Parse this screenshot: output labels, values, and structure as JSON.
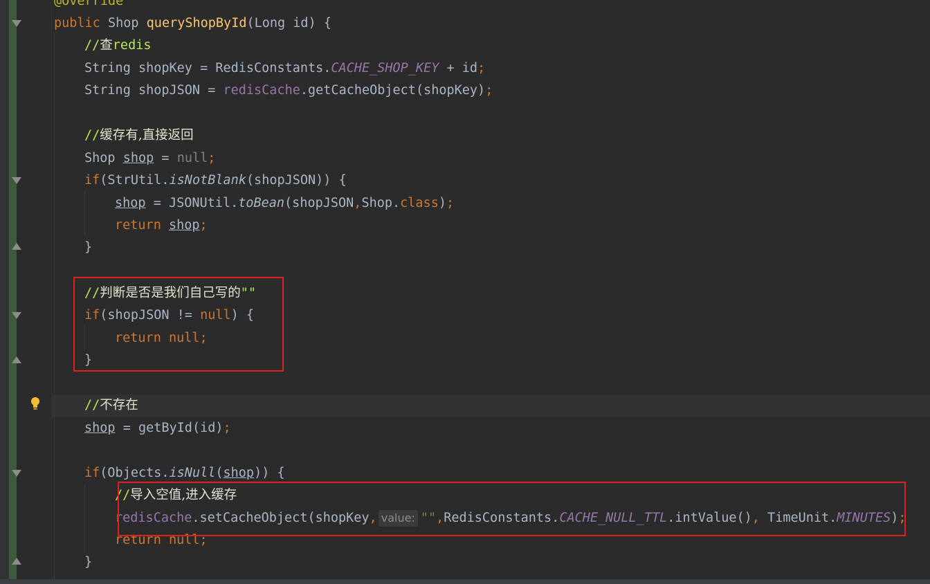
{
  "editor": {
    "annotation": "@Override",
    "lines": {
      "l1": {
        "kw_public": "public",
        "type": "Shop",
        "method": "queryShopById",
        "open": "(Long id) {"
      },
      "l2": {
        "prefix": "//",
        "word": "查",
        "rest": "redis"
      },
      "l3": {
        "a": "String shopKey = RedisConstants.",
        "const": "CACHE_SHOP_KEY",
        "b": " + id",
        "semi": ";"
      },
      "l4": {
        "a": "String shopJSON = ",
        "field": "redisCache",
        "b": ".getCacheObject(shopKey)",
        "semi": ";"
      },
      "l6": {
        "prefix": "//",
        "text": "缓存有,直接返回"
      },
      "l7": {
        "a": "Shop ",
        "var": "shop",
        "b": " = ",
        "null": "null",
        "semi": ";"
      },
      "l8": {
        "kw": "if",
        "a": "(StrUtil.",
        "m": "isNotBlank",
        "b": "(shopJSON)) {"
      },
      "l9": {
        "var": "shop",
        "a": " = JSONUtil.",
        "m": "toBean",
        "b": "(shopJSON",
        "comma": ",",
        "c": "Shop.",
        "kw": "class",
        "d": ")",
        "semi": ";"
      },
      "l10": {
        "kw": "return",
        "var": "shop",
        "semi": ";"
      },
      "l11": {
        "brace": "}"
      },
      "l13": {
        "prefix": "//",
        "text": "判断是否是我们自己写的",
        "quotes": "\"\""
      },
      "l14": {
        "kw": "if",
        "a": "(shopJSON != ",
        "null": "null",
        "b": ") {"
      },
      "l15": {
        "kw": "return",
        "null": "null",
        "semi": ";"
      },
      "l16": {
        "brace": "}"
      },
      "l18": {
        "prefix": "//",
        "text": "不存在"
      },
      "l19": {
        "var": "shop",
        "a": " = getById(id)",
        "semi": ";"
      },
      "l21": {
        "kw": "if",
        "a": "(Objects.",
        "m": "isNull",
        "b": "(",
        "var": "shop",
        "c": ")) {"
      },
      "l22": {
        "prefix": "//",
        "text": "导入空值,进入缓存"
      },
      "l23": {
        "field": "redisCache",
        "a": ".setCacheObject(shopKey",
        "comma": ",",
        "hint": "value:",
        "str": "\"\"",
        "comma2": ",",
        "b": "RedisConstants.",
        "const": "CACHE_NULL_TTL",
        "c": ".intValue()",
        "comma3": ",",
        "d": " TimeUnit.",
        "const2": "MINUTES",
        "e": ")",
        "semi": ";"
      },
      "l24": {
        "kw": "return",
        "null": "null",
        "semi": ";"
      },
      "l25": {
        "brace": "}"
      }
    }
  },
  "colors": {
    "keyword": "#cc7832",
    "method": "#ffc66d",
    "comment": "#b5e853",
    "field": "#9876aa",
    "string": "#6a8759",
    "highlight_box": "#e02020"
  }
}
